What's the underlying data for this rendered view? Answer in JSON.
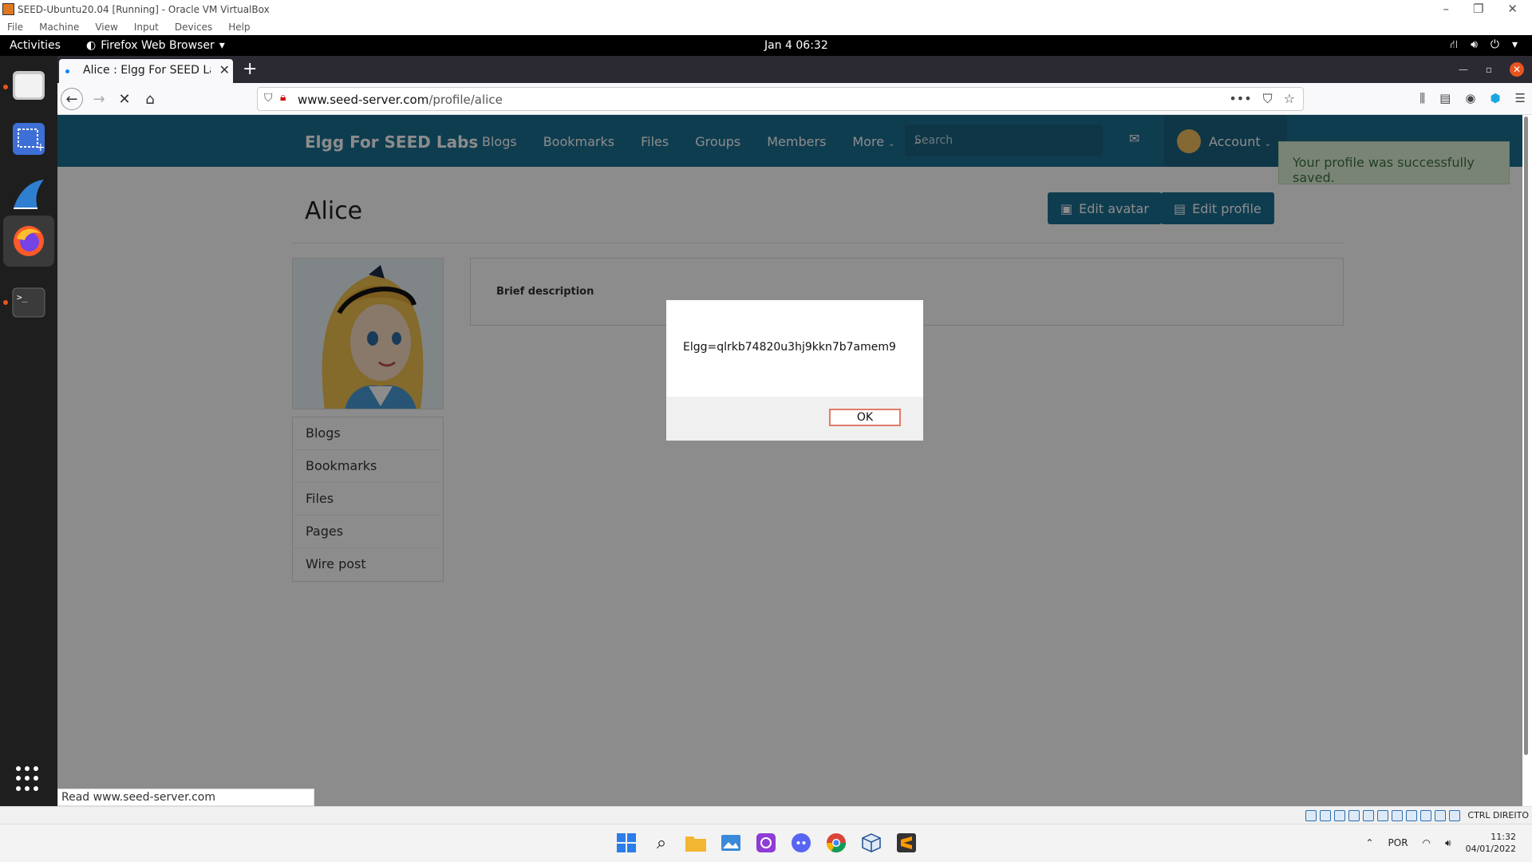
{
  "virtualbox": {
    "title": "SEED-Ubuntu20.04 [Running] - Oracle VM VirtualBox",
    "menu": [
      "File",
      "Machine",
      "View",
      "Input",
      "Devices",
      "Help"
    ],
    "status_key": "CTRL DIREITO"
  },
  "gnome": {
    "activities": "Activities",
    "app_name": "Firefox Web Browser",
    "clock": "Jan 4  06:32"
  },
  "firefox": {
    "tab_title": "Alice : Elgg For SEED Labs",
    "url_host": "www.seed-server.com",
    "url_path": "/profile/alice",
    "status_link": "Read www.seed-server.com"
  },
  "elgg": {
    "site_name": "Elgg For SEED Labs",
    "nav": [
      "Blogs",
      "Bookmarks",
      "Files",
      "Groups",
      "Members",
      "More"
    ],
    "search_placeholder": "Search",
    "account_label": "Account",
    "success_message": "Your profile was successfully saved.",
    "profile_name": "Alice",
    "edit_avatar": "Edit avatar",
    "edit_profile": "Edit profile",
    "brief_description_label": "Brief description",
    "owner_menu": [
      "Blogs",
      "Bookmarks",
      "Files",
      "Pages",
      "Wire post"
    ]
  },
  "alert": {
    "message": "Elgg=qlrkb74820u3hj9kkn7b7amem9",
    "ok_label": "OK"
  },
  "taskbar": {
    "language": "POR",
    "time": "11:32",
    "date": "04/01/2022"
  },
  "colors": {
    "elgg_blue": "#1d6f93",
    "ubuntu_orange": "#e95420",
    "success_bg": "#dff0d8"
  }
}
